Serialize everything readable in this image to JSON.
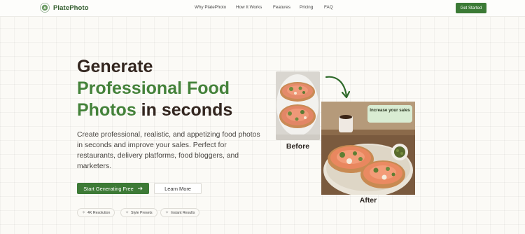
{
  "brand": {
    "name": "PlatePhoto",
    "logo_icon": "plate-logo-icon"
  },
  "nav": {
    "links": [
      "Why PlatePhoto",
      "How It Works",
      "Features",
      "Pricing",
      "FAQ"
    ],
    "cta": "Get Started"
  },
  "hero": {
    "title_line1": "Generate",
    "title_highlight1": "Professional Food",
    "title_highlight2": "Photos",
    "title_rest": " in seconds",
    "description": "Create professional, realistic, and appetizing food photos in seconds and improve your sales. Perfect for restaurants, delivery platforms, food bloggers, and marketers.",
    "primary_button": "Start Generating Free",
    "primary_button_icon": "arrow-right-icon",
    "secondary_button": "Learn More",
    "chips": [
      "4K Resolution",
      "Style Presets",
      "Instant Results"
    ]
  },
  "comparison": {
    "before_label": "Before",
    "after_label": "After",
    "badge": "Increase your sales"
  },
  "colors": {
    "accent": "#3d7a36",
    "heading": "#33261f",
    "highlight": "#44823a",
    "badge_bg": "#d9ecd3"
  }
}
